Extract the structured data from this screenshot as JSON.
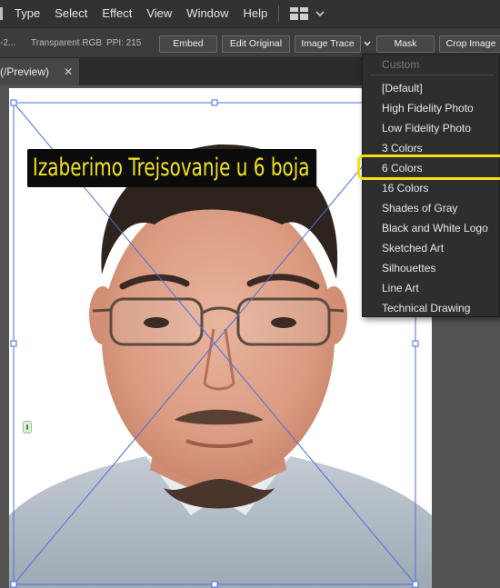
{
  "menubar": {
    "items": [
      "File",
      "Type",
      "Select",
      "Effect",
      "View",
      "Window",
      "Help"
    ],
    "workspace_icon": "workspace-grid-icon",
    "workspace_caret_icon": "chevron-down-icon"
  },
  "controlbar": {
    "filename_fragment": "-2...",
    "color_mode": "Transparent RGB",
    "ppi": "PPI: 215",
    "buttons": {
      "embed": "Embed",
      "edit_original": "Edit Original",
      "image_trace": "Image Trace",
      "mask": "Mask",
      "crop_image": "Crop Image"
    }
  },
  "document_tab": {
    "title": "(/Preview)",
    "close": "✕"
  },
  "caption": {
    "text": "Izaberimo Trejsovanje u 6 boja",
    "text_color": "#f2e21b",
    "background": "#0b0b0b"
  },
  "trace_menu": {
    "items": [
      {
        "label": "Custom",
        "enabled": false
      },
      {
        "label": "[Default]",
        "enabled": true
      },
      {
        "label": "High Fidelity Photo",
        "enabled": true
      },
      {
        "label": "Low Fidelity Photo",
        "enabled": true
      },
      {
        "label": "3 Colors",
        "enabled": true
      },
      {
        "label": "6 Colors",
        "enabled": true,
        "highlighted": true
      },
      {
        "label": "16 Colors",
        "enabled": true
      },
      {
        "label": "Shades of Gray",
        "enabled": true
      },
      {
        "label": "Black and White Logo",
        "enabled": true
      },
      {
        "label": "Sketched Art",
        "enabled": true
      },
      {
        "label": "Silhouettes",
        "enabled": true
      },
      {
        "label": "Line Art",
        "enabled": true
      },
      {
        "label": "Technical Drawing",
        "enabled": true
      }
    ],
    "highlight_color": "#f5df12"
  },
  "colors": {
    "selection_blue": "#4a6ee0",
    "app_dark": "#323232",
    "canvas": "#535353"
  }
}
